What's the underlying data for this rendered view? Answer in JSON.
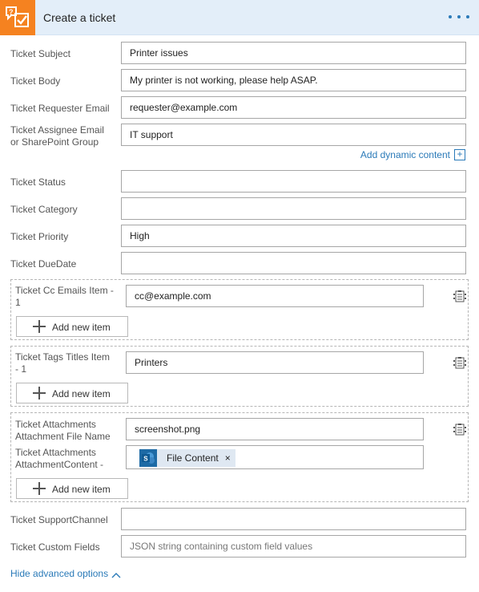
{
  "header": {
    "title": "Create a ticket",
    "icon": "ticket-check-icon",
    "accent": "#f58220",
    "background": "#e3eef9"
  },
  "fields": {
    "subject": {
      "label": "Ticket Subject",
      "value": "Printer issues"
    },
    "body": {
      "label": "Ticket Body",
      "value": "My printer is not working, please help ASAP."
    },
    "requester": {
      "label": "Ticket Requester Email",
      "value": "requester@example.com"
    },
    "assignee": {
      "label_line1": "Ticket Assignee Email",
      "label_line2": "or SharePoint Group",
      "value": "IT support"
    },
    "dynamic_content": "Add dynamic content",
    "status": {
      "label": "Ticket Status",
      "value": ""
    },
    "category": {
      "label": "Ticket Category",
      "value": ""
    },
    "priority": {
      "label": "Ticket Priority",
      "value": "High"
    },
    "duedate": {
      "label": "Ticket DueDate",
      "value": ""
    }
  },
  "cc_group": {
    "label_line1": "Ticket Cc Emails Item -",
    "label_line2": "1",
    "value": "cc@example.com",
    "add_label": "Add new item"
  },
  "tags_group": {
    "label_line1": "Ticket Tags Titles Item",
    "label_line2": "- 1",
    "value": "Printers",
    "add_label": "Add new item"
  },
  "attach_group": {
    "name_label_line1": "Ticket Attachments",
    "name_label_line2": "Attachment File Name",
    "name_value": "screenshot.png",
    "content_label_line1": "Ticket Attachments",
    "content_label_line2": "AttachmentContent -",
    "token_label": "File Content",
    "token_close": "×",
    "add_label": "Add new item"
  },
  "support_channel": {
    "label": "Ticket SupportChannel",
    "value": ""
  },
  "custom_fields": {
    "label": "Ticket Custom Fields",
    "placeholder": "JSON string containing custom field values"
  },
  "advanced_link": "Hide advanced options",
  "colors": {
    "link": "#2a7ab8",
    "sharepoint": "#1d6aa5",
    "token_bg": "#dfe8f2"
  }
}
